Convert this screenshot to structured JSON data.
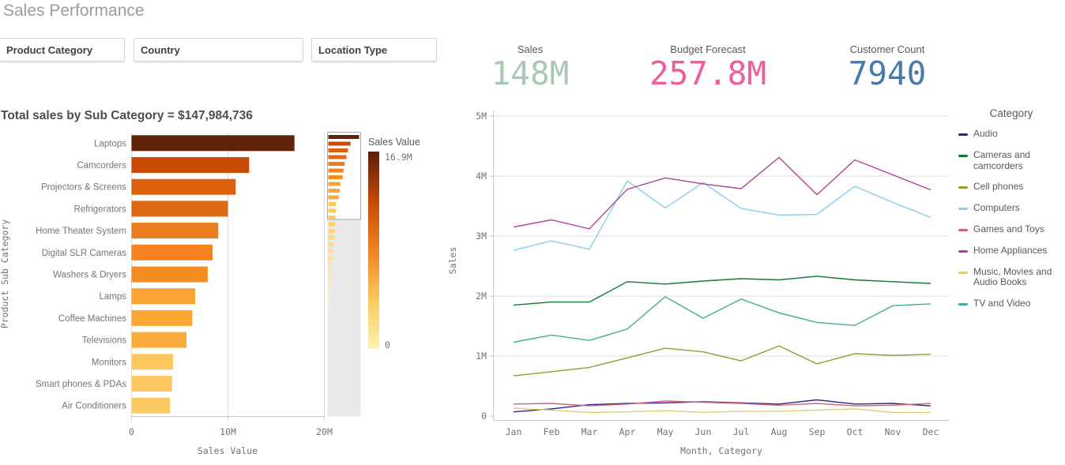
{
  "title": "Sales Performance",
  "filters": [
    {
      "label": "Product Category"
    },
    {
      "label": "Country"
    },
    {
      "label": "Location Type"
    }
  ],
  "kpis": [
    {
      "label": "Sales",
      "value": "148M",
      "color": "#a9c9b3"
    },
    {
      "label": "Budget Forecast",
      "value": "257.8M",
      "color": "#ef5b9d"
    },
    {
      "label": "Customer Count",
      "value": "7940",
      "color": "#4879ad"
    }
  ],
  "chart_data": [
    {
      "type": "bar",
      "orientation": "horizontal",
      "title": "Total sales by Sub Category = $147,984,736",
      "xlabel": "Sales Value",
      "ylabel": "Product Sub Category",
      "x_ticks": [
        {
          "label": "0",
          "value": 0
        },
        {
          "label": "10M",
          "value": 10
        },
        {
          "label": "20M",
          "value": 20
        }
      ],
      "xlim_millions": [
        0,
        20.5
      ],
      "categories": [
        "Laptops",
        "Camcorders",
        "Projectors & Screens",
        "Refrigerators",
        "Home Theater System",
        "Digital SLR Cameras",
        "Washers & Dryers",
        "Lamps",
        "Coffee Machines",
        "Televisions",
        "Monitors",
        "Smart phones & PDAs",
        "Air Conditioners"
      ],
      "values_millions": [
        16.9,
        12.2,
        10.8,
        10.0,
        9.0,
        8.4,
        7.9,
        6.6,
        6.3,
        5.7,
        4.3,
        4.2,
        4.0
      ],
      "bar_colors": [
        "#5f2309",
        "#c84a04",
        "#dc600c",
        "#e06a14",
        "#ec7d1e",
        "#f5821e",
        "#f58c22",
        "#f9a433",
        "#faa735",
        "#fbac3c",
        "#fdc75f",
        "#fdc75f",
        "#fdca62"
      ],
      "color_legend": {
        "title": "Sales Value",
        "max_label": "16.9M",
        "min_label": "0",
        "stops": [
          "#5a1e05",
          "#c44a06",
          "#ef8220",
          "#fcc95e",
          "#fdf2ad"
        ]
      },
      "minimap": {
        "visible_count": 13,
        "values_millions": [
          16.9,
          12.2,
          10.8,
          10.0,
          9.0,
          8.4,
          7.9,
          6.6,
          6.3,
          5.7,
          4.3,
          4.2,
          4.0,
          3.8,
          3.5,
          3.2,
          2.9,
          2.6,
          2.3,
          2.0,
          1.7,
          1.5,
          1.2,
          0.9,
          0.7,
          0.4
        ],
        "colors": [
          "#5f2309",
          "#c84a04",
          "#dc600c",
          "#e06a14",
          "#ec7d1e",
          "#f5821e",
          "#f58c22",
          "#f9a433",
          "#faa735",
          "#fbac3c",
          "#fdc75f",
          "#fdc75f",
          "#fdca62",
          "#fdcf6b",
          "#fdd274",
          "#fdd67d",
          "#fdd986",
          "#fddc8f",
          "#fde098",
          "#fde3a1",
          "#fde7aa",
          "#feeab3",
          "#feedbb",
          "#fef0c3",
          "#fef3cb",
          "#fef6d3"
        ]
      }
    },
    {
      "type": "line",
      "xlabel": "Month, Category",
      "ylabel": "Sales",
      "legend_title": "Category",
      "x": [
        "Jan",
        "Feb",
        "Mar",
        "Apr",
        "May",
        "Jun",
        "Jul",
        "Aug",
        "Sep",
        "Oct",
        "Nov",
        "Dec"
      ],
      "y_ticks": [
        {
          "label": "0",
          "value": 0
        },
        {
          "label": "1M",
          "value": 1
        },
        {
          "label": "2M",
          "value": 2
        },
        {
          "label": "3M",
          "value": 3
        },
        {
          "label": "4M",
          "value": 4
        },
        {
          "label": "5M",
          "value": 5
        }
      ],
      "ylim_millions": [
        0,
        5.2
      ],
      "series": [
        {
          "name": "Audio",
          "color": "#332288",
          "values_millions": [
            0.07,
            0.12,
            0.19,
            0.21,
            0.22,
            0.24,
            0.22,
            0.2,
            0.27,
            0.2,
            0.21,
            0.17
          ]
        },
        {
          "name": "Cameras and camcorders",
          "color": "#117733",
          "values_millions": [
            1.85,
            1.9,
            1.9,
            2.24,
            2.2,
            2.25,
            2.29,
            2.27,
            2.33,
            2.27,
            2.24,
            2.21
          ]
        },
        {
          "name": "Cell phones",
          "color": "#999933",
          "values_millions": [
            0.67,
            0.74,
            0.81,
            0.97,
            1.13,
            1.07,
            0.92,
            1.17,
            0.87,
            1.04,
            1.01,
            1.03
          ]
        },
        {
          "name": "Computers",
          "color": "#88ccee",
          "values_millions": [
            2.76,
            2.92,
            2.78,
            3.92,
            3.47,
            3.89,
            3.46,
            3.35,
            3.36,
            3.83,
            3.56,
            3.31
          ]
        },
        {
          "name": "Games and Toys",
          "color": "#cc6677",
          "values_millions": [
            0.2,
            0.21,
            0.17,
            0.2,
            0.25,
            0.23,
            0.21,
            0.18,
            0.21,
            0.17,
            0.18,
            0.21
          ]
        },
        {
          "name": "Home Appliances",
          "color": "#aa4499",
          "values_millions": [
            3.15,
            3.27,
            3.12,
            3.78,
            3.97,
            3.87,
            3.79,
            4.31,
            3.69,
            4.27,
            4.02,
            3.77
          ]
        },
        {
          "name": "Music, Movies and Audio Books",
          "color": "#ddcc77",
          "values_millions": [
            0.13,
            0.1,
            0.06,
            0.07,
            0.09,
            0.06,
            0.08,
            0.08,
            0.1,
            0.12,
            0.06,
            0.06
          ]
        },
        {
          "name": "TV and Video",
          "color": "#44aa99",
          "values_millions": [
            1.23,
            1.35,
            1.26,
            1.45,
            1.99,
            1.63,
            1.95,
            1.72,
            1.56,
            1.51,
            1.84,
            1.87
          ]
        }
      ]
    }
  ]
}
